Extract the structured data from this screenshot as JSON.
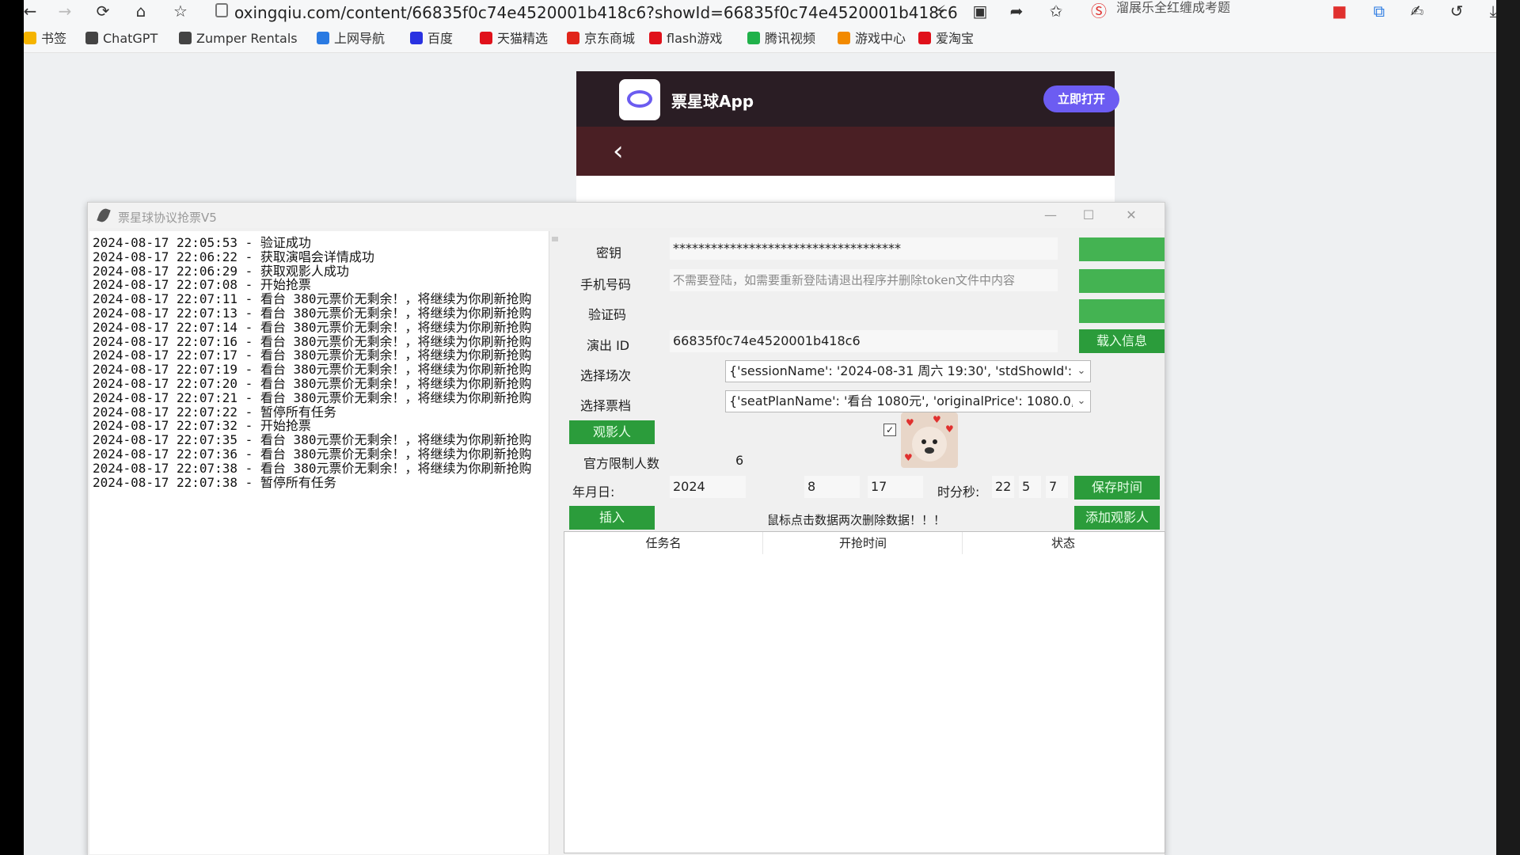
{
  "browser": {
    "url": "oxingqiu.com/content/66835f0c74e4520001b418c6?showId=66835f0c74e4520001b418c6",
    "promo_text": "溜展乐全红缠成考题",
    "bookmarks": [
      {
        "label": "书签",
        "icon": "star-icon",
        "color": "#f5b400"
      },
      {
        "label": "ChatGPT",
        "icon": "chatgpt-icon",
        "color": "#444444"
      },
      {
        "label": "Zumper Rentals",
        "icon": "zumper-icon",
        "color": "#444444"
      },
      {
        "label": "上网导航",
        "icon": "nav-icon",
        "color": "#2a7ae2"
      },
      {
        "label": "百度",
        "icon": "baidu-icon",
        "color": "#2932e1"
      },
      {
        "label": "天猫精选",
        "icon": "tmall-icon",
        "color": "#e0111b"
      },
      {
        "label": "京东商城",
        "icon": "jd-icon",
        "color": "#e1251b"
      },
      {
        "label": "flash游戏",
        "icon": "flash-icon",
        "color": "#e0111b"
      },
      {
        "label": "腾讯视频",
        "icon": "tencent-video-icon",
        "color": "#20b14a"
      },
      {
        "label": "游戏中心",
        "icon": "game-center-icon",
        "color": "#f28a00"
      },
      {
        "label": "爱淘宝",
        "icon": "taobao-icon",
        "color": "#e0111b"
      }
    ]
  },
  "webpage": {
    "app_name": "票星球App",
    "open_button": "立即打开",
    "accent": "#6c5cf2"
  },
  "window": {
    "title": "票星球协议抢票V5",
    "log": [
      "2024-08-17 22:05:53 - 验证成功",
      "2024-08-17 22:06:22 - 获取演唱会详情成功",
      "2024-08-17 22:06:29 - 获取观影人成功",
      "2024-08-17 22:07:08 - 开始抢票",
      "2024-08-17 22:07:11 - 看台 380元票价无剩余！，将继续为你刷新抢购",
      "2024-08-17 22:07:13 - 看台 380元票价无剩余！，将继续为你刷新抢购",
      "2024-08-17 22:07:14 - 看台 380元票价无剩余！，将继续为你刷新抢购",
      "2024-08-17 22:07:16 - 看台 380元票价无剩余！，将继续为你刷新抢购",
      "2024-08-17 22:07:17 - 看台 380元票价无剩余！，将继续为你刷新抢购",
      "2024-08-17 22:07:19 - 看台 380元票价无剩余！，将继续为你刷新抢购",
      "2024-08-17 22:07:20 - 看台 380元票价无剩余！，将继续为你刷新抢购",
      "2024-08-17 22:07:21 - 看台 380元票价无剩余！，将继续为你刷新抢购",
      "2024-08-17 22:07:22 - 暂停所有任务",
      "2024-08-17 22:07:32 - 开始抢票",
      "2024-08-17 22:07:35 - 看台 380元票价无剩余！，将继续为你刷新抢购",
      "2024-08-17 22:07:36 - 看台 380元票价无剩余！，将继续为你刷新抢购",
      "2024-08-17 22:07:38 - 看台 380元票价无剩余！，将继续为你刷新抢购",
      "2024-08-17 22:07:38 - 暂停所有任务"
    ],
    "form": {
      "key_label": "密钥",
      "key_value": "************************************",
      "phone_label": "手机号码",
      "phone_placeholder": "不需要登陆，如需要重新登陆请退出程序并删除token文件中内容",
      "code_label": "验证码",
      "show_id_label": "演出 ID",
      "show_id_value": "66835f0c74e4520001b418c6",
      "load_button": "载入信息",
      "session_label": "选择场次",
      "session_value": "{'sessionName': '2024-08-31 周六 19:30', 'stdShowId': '",
      "ticket_label": "选择票档",
      "ticket_value": "{'seatPlanName': '看台 1080元', 'originalPrice': 1080.0, '",
      "viewer_button": "观影人",
      "limit_label": "官方限制人数",
      "limit_value": "6",
      "date_label": "年月日:",
      "year": "2024",
      "month": "8",
      "day": "17",
      "time_label": "时分秒:",
      "hour": "22",
      "minute": "5",
      "second": "7",
      "save_time_button": "保存时间",
      "insert_button": "插入",
      "delete_hint": "鼠标点击数据两次删除数据！！！",
      "add_viewer_button": "添加观影人"
    },
    "table": {
      "headers": [
        "任务名",
        "开抢时间",
        "状态"
      ]
    },
    "colors": {
      "button_green": "#2b9c3b"
    }
  }
}
